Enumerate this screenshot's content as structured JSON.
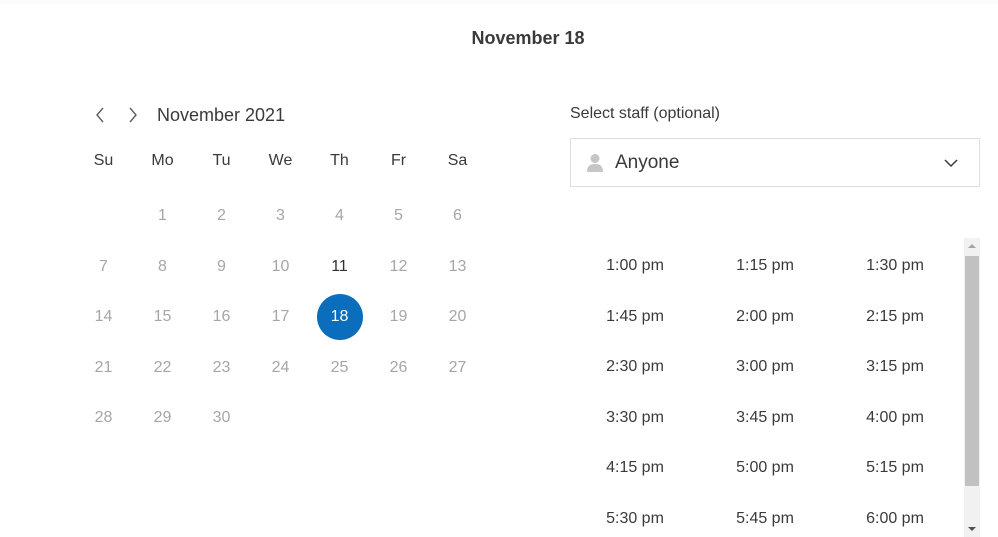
{
  "page_title": "November 18",
  "calendar": {
    "month_label": "November 2021",
    "prev_icon": "chevron-left-icon",
    "next_icon": "chevron-right-icon",
    "weekdays": [
      "Su",
      "Mo",
      "Tu",
      "We",
      "Th",
      "Fr",
      "Sa"
    ],
    "days": [
      "",
      "1",
      "2",
      "3",
      "4",
      "5",
      "6",
      "7",
      "8",
      "9",
      "10",
      "11",
      "12",
      "13",
      "14",
      "15",
      "16",
      "17",
      "18",
      "19",
      "20",
      "21",
      "22",
      "23",
      "24",
      "25",
      "26",
      "27",
      "28",
      "29",
      "30"
    ],
    "available_days": [
      "11",
      "18"
    ],
    "selected_day": "18",
    "accent_color": "#0a6ebd"
  },
  "staff": {
    "label": "Select staff (optional)",
    "value": "Anyone",
    "icon": "person-icon",
    "dropdown_icon": "chevron-down-icon"
  },
  "time_slots": [
    "1:00 pm",
    "1:15 pm",
    "1:30 pm",
    "1:45 pm",
    "2:00 pm",
    "2:15 pm",
    "2:30 pm",
    "3:00 pm",
    "3:15 pm",
    "3:30 pm",
    "3:45 pm",
    "4:00 pm",
    "4:15 pm",
    "5:00 pm",
    "5:15 pm",
    "5:30 pm",
    "5:45 pm",
    "6:00 pm"
  ]
}
